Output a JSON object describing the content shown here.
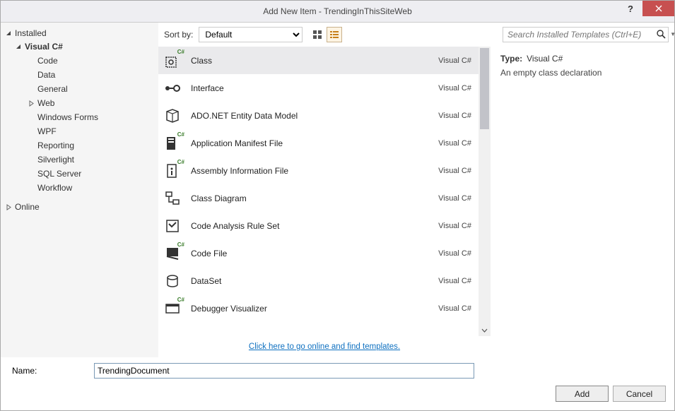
{
  "window": {
    "title": "Add New Item - TrendingInThisSiteWeb"
  },
  "sidebar": {
    "installed_label": "Installed",
    "online_label": "Online",
    "root": "Visual C#",
    "children": [
      "Code",
      "Data",
      "General",
      "Web",
      "Windows Forms",
      "WPF",
      "Reporting",
      "Silverlight",
      "SQL Server",
      "Workflow"
    ]
  },
  "toolbar": {
    "sort_label": "Sort by:",
    "sort_value": "Default",
    "search_placeholder": "Search Installed Templates (Ctrl+E)"
  },
  "items": [
    {
      "name": "Class",
      "lang": "Visual C#"
    },
    {
      "name": "Interface",
      "lang": "Visual C#"
    },
    {
      "name": "ADO.NET Entity Data Model",
      "lang": "Visual C#"
    },
    {
      "name": "Application Manifest File",
      "lang": "Visual C#"
    },
    {
      "name": "Assembly Information File",
      "lang": "Visual C#"
    },
    {
      "name": "Class Diagram",
      "lang": "Visual C#"
    },
    {
      "name": "Code Analysis Rule Set",
      "lang": "Visual C#"
    },
    {
      "name": "Code File",
      "lang": "Visual C#"
    },
    {
      "name": "DataSet",
      "lang": "Visual C#"
    },
    {
      "name": "Debugger Visualizer",
      "lang": "Visual C#"
    }
  ],
  "link_text": "Click here to go online and find templates.",
  "details": {
    "type_label": "Type:",
    "type_value": "Visual C#",
    "description": "An empty class declaration"
  },
  "name_field": {
    "label": "Name:",
    "value": "TrendingDocument"
  },
  "buttons": {
    "add": "Add",
    "cancel": "Cancel"
  }
}
